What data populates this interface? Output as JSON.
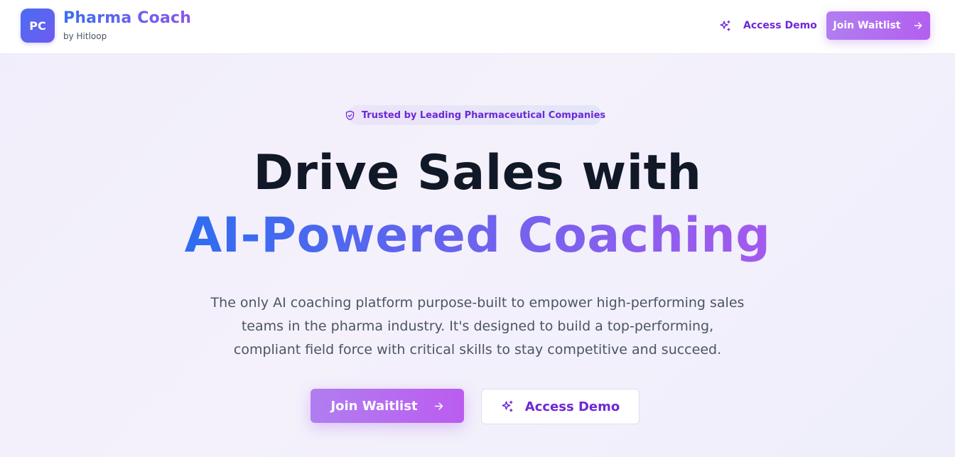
{
  "header": {
    "logo_initials": "PC",
    "brand_name": "Pharma Coach",
    "brand_sub": "by Hitloop",
    "access_demo_label": "Access Demo",
    "join_waitlist_label": "Join Waitlist"
  },
  "hero": {
    "trust_badge": "Trusted by Leading Pharmaceutical Companies",
    "headline_line1": "Drive Sales with",
    "headline_line2": "AI-Powered Coaching",
    "description": "The only AI coaching platform purpose-built to empower high-performing sales teams in the pharma industry. It's designed to build a top-performing, compliant field force with critical skills to stay competitive and succeed.",
    "cta_primary_label": "Join Waitlist",
    "cta_secondary_label": "Access Demo"
  },
  "icons": {
    "sparkle": "sparkles-icon",
    "arrow": "arrow-right-icon",
    "shield": "shield-check-icon"
  },
  "colors": {
    "accent_purple": "#6d28d9",
    "gradient_blue": "#2f6cf0",
    "gradient_violet": "#a45aee",
    "button_gradient_start": "#b07ef0",
    "button_gradient_end": "#bb5cf0",
    "headline_dark": "#111827"
  }
}
